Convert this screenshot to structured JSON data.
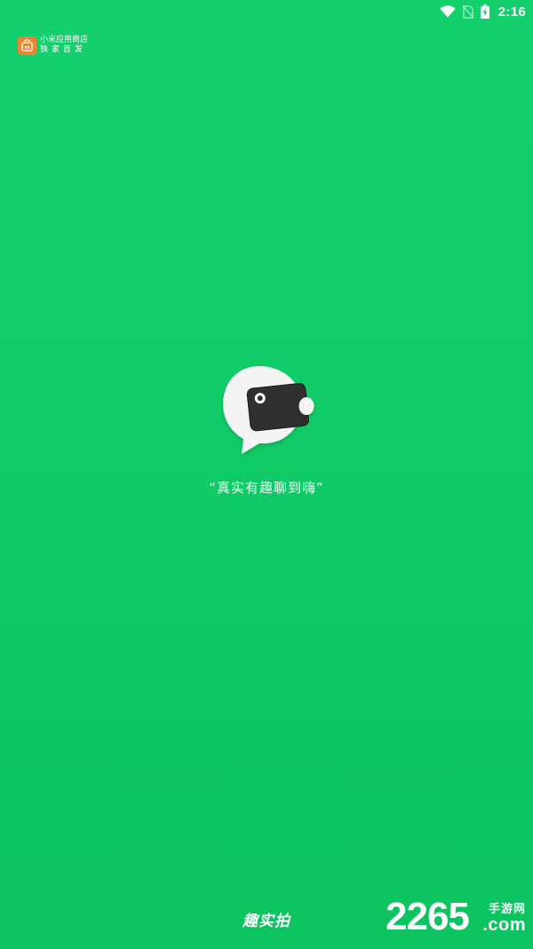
{
  "status_bar": {
    "time": "2:16",
    "icons": [
      "wifi-icon",
      "no-sim-icon",
      "battery-charging-icon"
    ]
  },
  "store_badge": {
    "name": "小米应用商店",
    "tagline": "独家首发",
    "logo_color": "#f0832d"
  },
  "splash": {
    "slogan": "“真实有趣聊到嗨”",
    "app_name": "趣实拍",
    "logo_icon": "chat-bubble-camera-icon",
    "background_color": "#11cc69"
  },
  "watermark": {
    "number": "2265",
    "site_cn": "手游网",
    "site_domain": ".com"
  }
}
